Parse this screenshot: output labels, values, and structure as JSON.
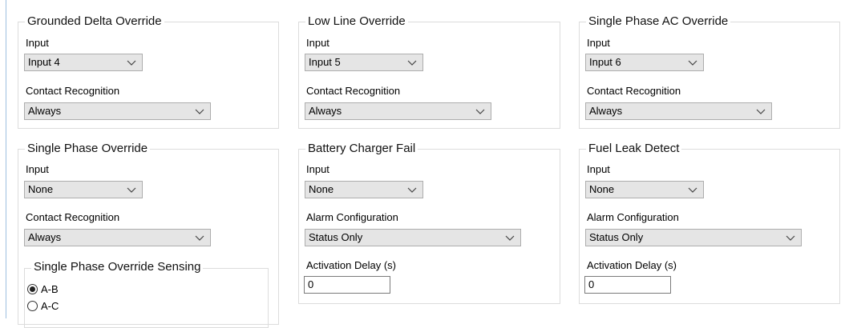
{
  "groups": {
    "grounded_delta": {
      "title": "Grounded Delta Override",
      "input_label": "Input",
      "input_value": "Input 4",
      "contact_label": "Contact Recognition",
      "contact_value": "Always"
    },
    "low_line": {
      "title": "Low Line Override",
      "input_label": "Input",
      "input_value": "Input 5",
      "contact_label": "Contact Recognition",
      "contact_value": "Always"
    },
    "single_phase_ac": {
      "title": "Single Phase AC Override",
      "input_label": "Input",
      "input_value": "Input 6",
      "contact_label": "Contact Recognition",
      "contact_value": "Always"
    },
    "single_phase": {
      "title": "Single Phase Override",
      "input_label": "Input",
      "input_value": "None",
      "contact_label": "Contact Recognition",
      "contact_value": "Always",
      "sensing": {
        "title": "Single Phase Override Sensing",
        "options": [
          {
            "label": "A-B",
            "selected": true
          },
          {
            "label": "A-C",
            "selected": false
          }
        ]
      }
    },
    "battery_charger_fail": {
      "title": "Battery Charger Fail",
      "input_label": "Input",
      "input_value": "None",
      "alarm_label": "Alarm Configuration",
      "alarm_value": "Status Only",
      "delay_label": "Activation Delay (s)",
      "delay_value": "0"
    },
    "fuel_leak_detect": {
      "title": "Fuel Leak Detect",
      "input_label": "Input",
      "input_value": "None",
      "alarm_label": "Alarm Configuration",
      "alarm_value": "Status Only",
      "delay_label": "Activation Delay (s)",
      "delay_value": "0"
    }
  },
  "icons": {
    "dropdown": "chevron-down-icon",
    "radio_selected": "radio-selected-icon"
  }
}
